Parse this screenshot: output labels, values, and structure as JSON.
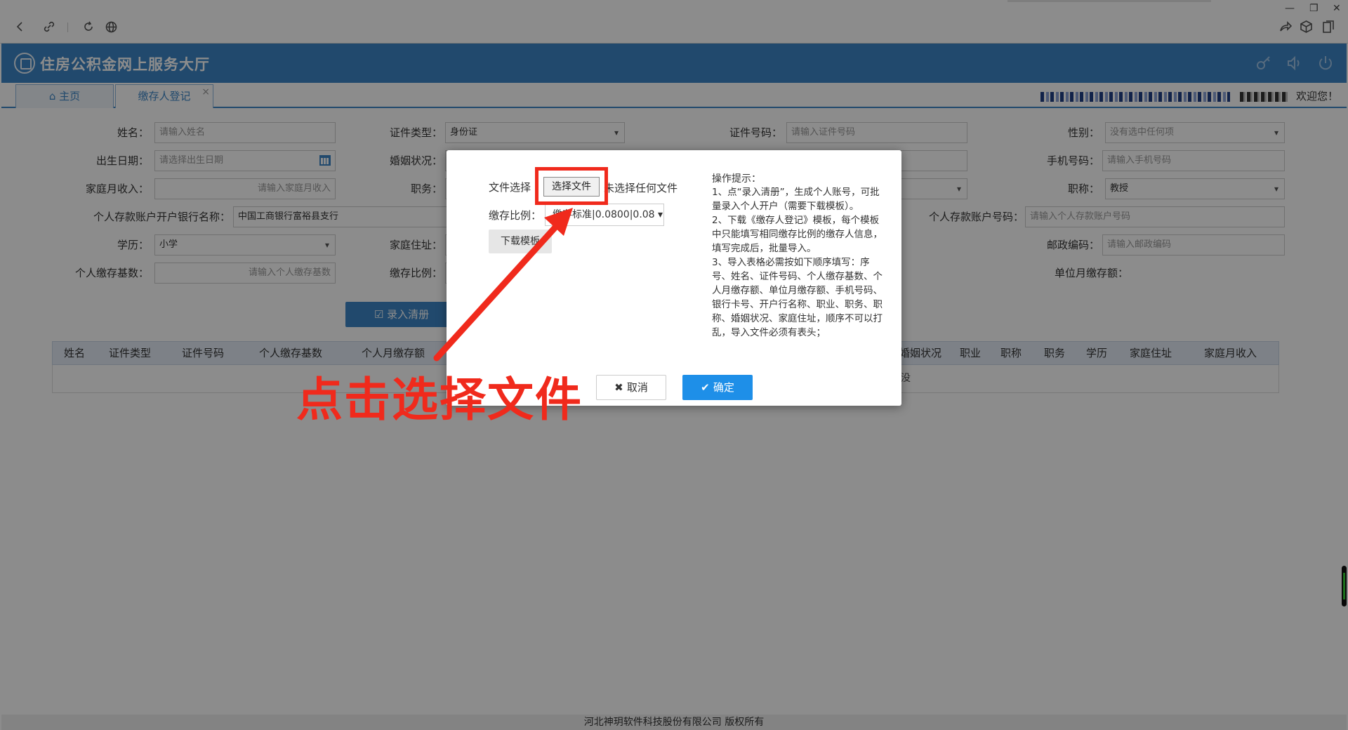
{
  "app": {
    "title": "住房公积金网上服务大厅",
    "welcome": "欢迎您！"
  },
  "tabs": [
    {
      "label": "主页"
    },
    {
      "label": "缴存人登记"
    }
  ],
  "form": {
    "name": {
      "label": "姓名：",
      "placeholder": "请输入姓名"
    },
    "id_type": {
      "label": "证件类型：",
      "value": "身份证"
    },
    "id_number": {
      "label": "证件号码：",
      "placeholder": "请输入证件号码"
    },
    "gender": {
      "label": "性别：",
      "placeholder": "没有选中任何项"
    },
    "birthdate": {
      "label": "出生日期：",
      "placeholder": "请选择出生日期"
    },
    "marital": {
      "label": "婚姻状况："
    },
    "mobile": {
      "label": "手机号码：",
      "placeholder": "请输入手机号码"
    },
    "family_income": {
      "label": "家庭月收入：",
      "placeholder": "请输入家庭月收入"
    },
    "position": {
      "label": "职务："
    },
    "title_rank": {
      "label": "职称：",
      "value": "教授"
    },
    "bank_name": {
      "label": "个人存款账户开户银行名称：",
      "value": "中国工商银行富裕县支行"
    },
    "bank_account": {
      "label": "个人存款账户号码：",
      "placeholder": "请输入个人存款账户号码"
    },
    "education": {
      "label": "学历：",
      "value": "小学"
    },
    "address": {
      "label": "家庭住址："
    },
    "postcode": {
      "label": "邮政编码：",
      "placeholder": "请输入邮政编码"
    },
    "base": {
      "label": "个人缴存基数：",
      "placeholder": "请输入个人缴存基数"
    },
    "ratio": {
      "label": "缴存比例："
    },
    "unit_monthly": {
      "label": "单位月缴存额："
    }
  },
  "enter_button": "录入清册",
  "grid": {
    "columns": [
      "姓名",
      "证件类型",
      "证件号码",
      "个人缴存基数",
      "个人月缴存额",
      "婚姻状况",
      "职业",
      "职称",
      "职务",
      "学历",
      "家庭住址",
      "家庭月收入"
    ],
    "empty_fragment": "没"
  },
  "footer": "河北神玥软件科技股份有限公司 版权所有",
  "modal": {
    "file_label": "文件选择",
    "file_button": "选择文件",
    "file_status": "未选择任何文件",
    "ratio_label": "缴存比例：",
    "ratio_value": "缴存标准|0.0800|0.08",
    "download_button": "下载模板",
    "hint_title": "操作提示：",
    "hints": [
      "1、点“录入清册”，生成个人账号，可批量录入个人开户（需要下载模板）。",
      "2、下载《缴存人登记》模板，每个模板中只能填写相同缴存比例的缴存人信息，填写完成后，批量导入。",
      "3、导入表格必需按如下顺序填写：序号、姓名、证件号码、个人缴存基数、个人月缴存额、单位月缴存额、手机号码、银行卡号、开户行名称、职业、职务、职称、婚姻状况、家庭住址，顺序不可以打乱，导入文件必须有表头；"
    ],
    "cancel": "取消",
    "ok": "确定"
  },
  "annotation": "点击选择文件",
  "colors": {
    "header": "#3c86c6",
    "annotation": "#f02a1c",
    "primary_button": "#1e8fe8"
  }
}
